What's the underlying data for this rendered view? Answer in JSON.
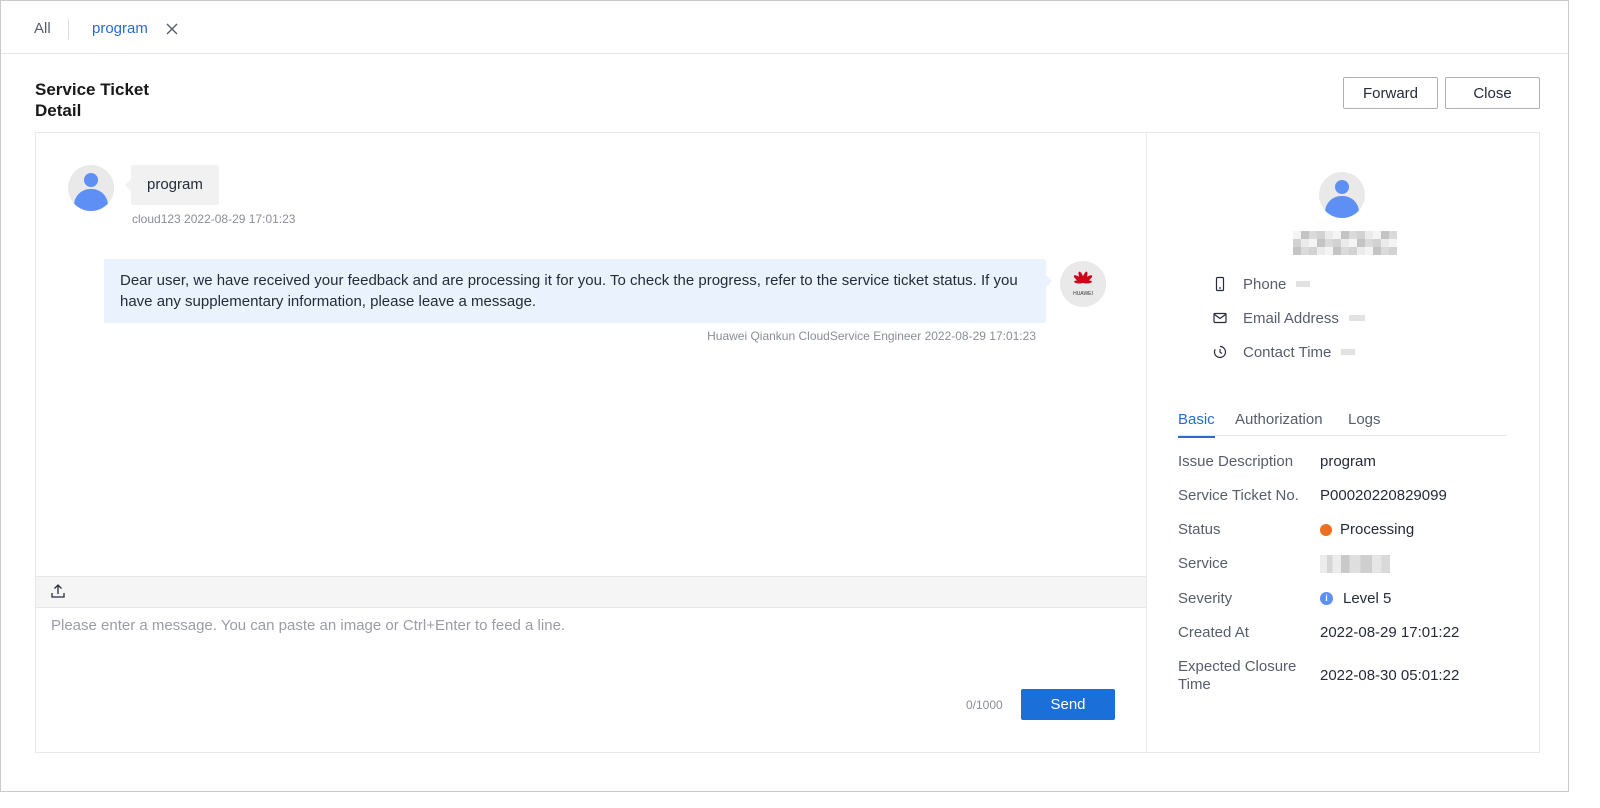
{
  "tabs": {
    "all": "All",
    "current": "program"
  },
  "page": {
    "title": "Service Ticket Detail"
  },
  "actions": {
    "forward": "Forward",
    "close": "Close"
  },
  "chat": {
    "user_message": "program",
    "user_meta": "cloud123 2022-08-29 17:01:23",
    "engineer_message": "Dear user, we have received your feedback and are processing it for you. To check the progress, refer to the service ticket status. If you have any supplementary information, please leave a message.",
    "engineer_meta": "Huawei Qiankun CloudService Engineer 2022-08-29 17:01:23",
    "engineer_avatar_text": "HUAWEI"
  },
  "composer": {
    "placeholder": "Please enter a message. You can paste an image or Ctrl+Enter to feed a line.",
    "counter": "0/1000",
    "send": "Send"
  },
  "contact": {
    "phone_label": "Phone",
    "email_label": "Email Address",
    "contact_time_label": "Contact Time"
  },
  "detail_tabs": [
    "Basic",
    "Authorization",
    "Logs"
  ],
  "details": {
    "issue_label": "Issue Description",
    "issue_value": "program",
    "ticket_label": "Service Ticket No.",
    "ticket_value": "P00020220829099",
    "status_label": "Status",
    "status_value": "Processing",
    "status_color": "#ed6f22",
    "service_label": "Service",
    "severity_label": "Severity",
    "severity_value": "Level 5",
    "created_label": "Created At",
    "created_value": "2022-08-29 17:01:22",
    "expected_label": "Expected Closure Time",
    "expected_value": "2022-08-30 05:01:22"
  },
  "colors": {
    "accent": "#1a6fd8",
    "link": "#2a6bd1",
    "engineer_bubble": "#eaf2fd",
    "huawei_red": "#d0021b"
  }
}
